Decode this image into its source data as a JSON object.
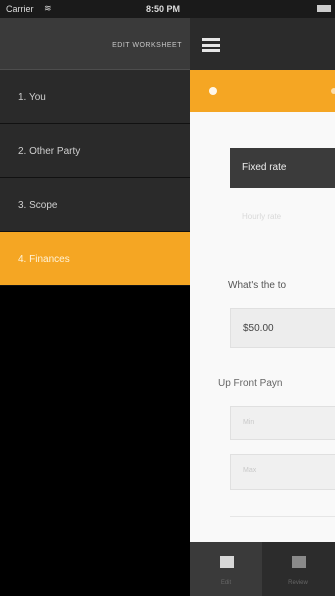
{
  "status_bar": {
    "carrier": "Carrier",
    "time": "8:50 PM"
  },
  "drawer": {
    "header_title": "EDIT WORKSHEET",
    "items": [
      {
        "label": "1. You",
        "active": false
      },
      {
        "label": "2. Other Party",
        "active": false
      },
      {
        "label": "3. Scope",
        "active": false
      },
      {
        "label": "4. Finances",
        "active": true
      }
    ]
  },
  "main": {
    "segment_selected": "Fixed rate",
    "segment_other": "Hourly rate",
    "question": "What's the to",
    "amount": "$50.00",
    "upfront_label": "Up Front Payn",
    "field1_placeholder": "Min",
    "field2_placeholder": "Max"
  },
  "tabbar": {
    "tab1_label": "Edit",
    "tab2_label": "Review"
  },
  "colors": {
    "accent": "#f5a623",
    "dark": "#2b2b2b"
  }
}
